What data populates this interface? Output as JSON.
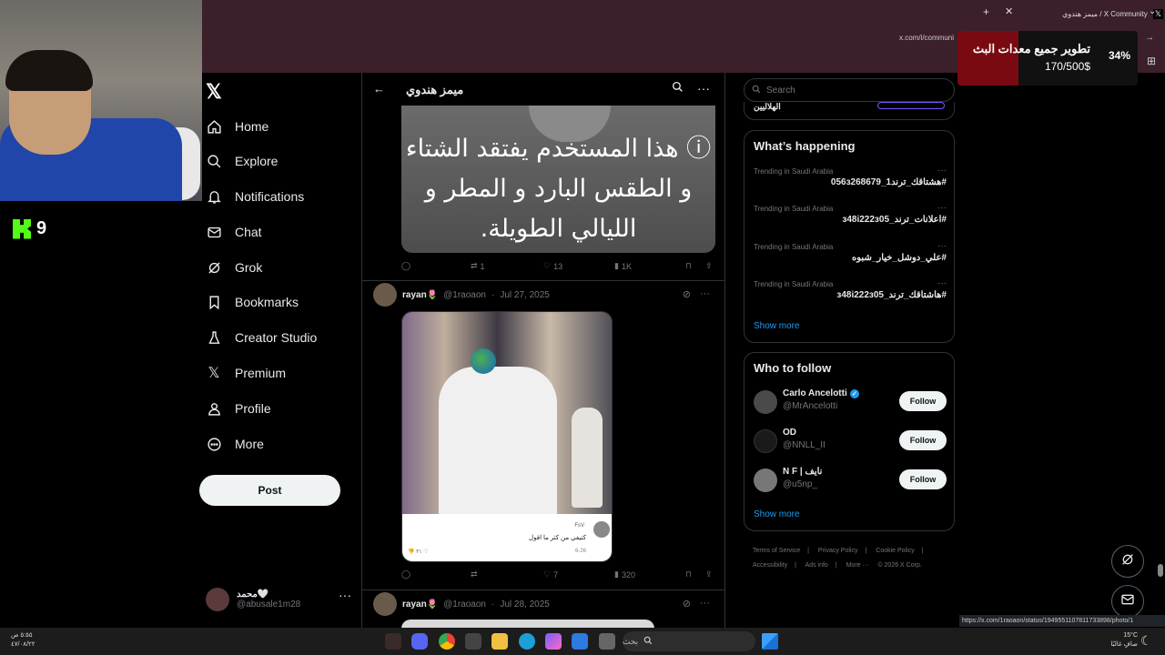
{
  "browser": {
    "tab_title": "ميمز هندوي / X Community",
    "url": "x.com/i/communi",
    "status_url": "https://x.com/1raoaon/status/1949551107811733898/photo/1"
  },
  "stream": {
    "kick_count": "9",
    "goal_title": "تطوير جميع معدات البث",
    "goal_amount": "170/500$",
    "goal_percent": "34%",
    "goal_fraction": 0.34
  },
  "nav": {
    "items": [
      {
        "label": "Home",
        "icon": "home-icon"
      },
      {
        "label": "Explore",
        "icon": "search-icon"
      },
      {
        "label": "Notifications",
        "icon": "bell-icon"
      },
      {
        "label": "Chat",
        "icon": "mail-icon"
      },
      {
        "label": "Grok",
        "icon": "grok-icon"
      },
      {
        "label": "Bookmarks",
        "icon": "bookmark-icon"
      },
      {
        "label": "Creator Studio",
        "icon": "flask-icon"
      },
      {
        "label": "Premium",
        "icon": "x-icon"
      },
      {
        "label": "Profile",
        "icon": "person-icon"
      },
      {
        "label": "More",
        "icon": "more-circle-icon"
      }
    ],
    "post_label": "Post",
    "account_name": "محمد🤍",
    "account_handle": "@abusale1m28"
  },
  "community": {
    "title": "ميمز هندوي"
  },
  "tweets": [
    {
      "image_text": "ⓘ هذا المستخدم يفتقد الشتاء و الطقس البارد و المطر و الليالي الطويلة.",
      "replies": "",
      "reposts": "1",
      "likes": "13",
      "views": "1K"
    },
    {
      "name": "rayan🌷",
      "handle": "@1raoaon",
      "date": "Jul 27, 2025",
      "card_user": "FsV·",
      "card_text": "كتيفي من كثر ما اقول",
      "card_date": "6-26",
      "card_likes": "٣١",
      "replies": "",
      "reposts": "",
      "likes": "7",
      "views": "320"
    },
    {
      "name": "rayan🌷",
      "handle": "@1raoaon",
      "date": "Jul 28, 2025"
    }
  ],
  "sidebar": {
    "search_placeholder": "Search",
    "partial_text": "الهلاليين",
    "happening_title": "What’s happening",
    "trends": [
      {
        "meta": "Trending in Saudi Arabia",
        "tag": "#هشتاقك_ترند1_056з268679"
      },
      {
        "meta": "Trending in Saudi Arabia",
        "tag": "#اعلانات_ترند_з48і222з05"
      },
      {
        "meta": "Trending in Saudi Arabia",
        "tag": "#علي_دوشل_خيار_شبوه"
      },
      {
        "meta": "Trending in Saudi Arabia",
        "tag": "#هاشتاقك_ترند_з48і222з05"
      }
    ],
    "show_more": "Show more",
    "follow_title": "Who to follow",
    "follow": [
      {
        "name": "Carlo Ancelotti",
        "handle": "@MrAncelotti",
        "verified": true,
        "button": "Follow"
      },
      {
        "name": "OD",
        "handle": "@NNLL_II",
        "verified": false,
        "button": "Follow"
      },
      {
        "name": "N F | نايف",
        "handle": "@u5np_",
        "verified": false,
        "button": "Follow"
      }
    ],
    "footer": [
      "Terms of Service",
      "|",
      "Privacy Policy",
      "|",
      "Cookie Policy",
      "|",
      "Accessibility",
      "|",
      "Ads info",
      "|",
      "More ···",
      "© 2026 X Corp."
    ]
  },
  "taskbar": {
    "time": "٥:٥٥ ص",
    "date": "٤٧/٠٨/٢٢",
    "search_placeholder": "بحث",
    "temp": "15°C",
    "weather": "صافٍ غالبًا"
  },
  "colors": {
    "accent": "#1d9bf0",
    "chrome": "#3b1f2b",
    "goal_fill": "#7a0a12",
    "kick_green": "#53fc18"
  }
}
